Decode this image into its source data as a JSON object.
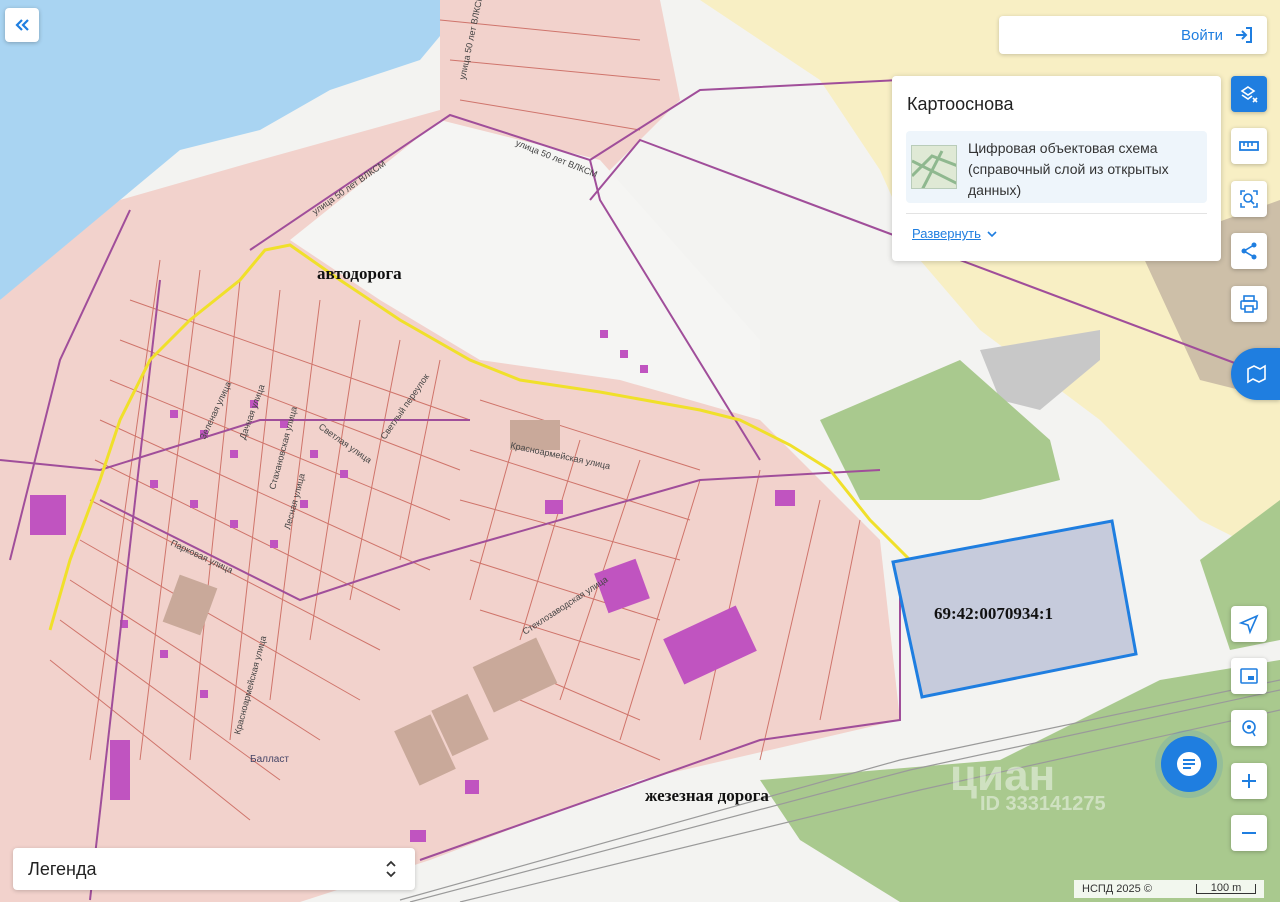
{
  "header": {
    "login_label": "Войти"
  },
  "basemap_panel": {
    "title": "Картооснова",
    "layer_name": "Цифровая объектовая схема (справочный слой из открытых данных)",
    "expand_label": "Развернуть"
  },
  "legend": {
    "label": "Легенда"
  },
  "map_labels": {
    "road": "автодорога",
    "railway": "жезезная дорога",
    "parcel_number": "69:42:0070934:1",
    "water_name": "Балласт",
    "watermark": "циан",
    "watermark_id": "ID 333141275"
  },
  "street_labels": [
    "улица 50 лет ВЛКСМ",
    "улица 50 лет ВЛКСМ",
    "улица 50 лет ВЛКСМ",
    "Красноармейская улица",
    "Стахановская улица",
    "Светлая улица",
    "Светлый переулок",
    "Зеленая улица",
    "Дачная улица",
    "Лесная улица",
    "Парковая улица",
    "Стеклозаводская улица",
    "Красноармейская улица"
  ],
  "attribution": "НСПД 2025 ©",
  "scale": "100 m",
  "icons": [
    "collapse-icon",
    "login-icon",
    "layers-clear-icon",
    "ruler-icon",
    "search-area-icon",
    "share-icon",
    "print-icon",
    "map-tool-icon",
    "navigate-icon",
    "minimap-icon",
    "locate-icon",
    "zoom-in-icon",
    "zoom-out-icon",
    "chat-icon",
    "chevron-down-icon",
    "up-down-icon"
  ],
  "colors": {
    "accent": "#1f7ee0",
    "parcel_fill": "#f2d2cc",
    "parcel_line": "#c9645a",
    "boundary": "#a04e9a",
    "road_highlight": "#f0e02a",
    "water": "#a9d4f2",
    "forest": "#a9c98e",
    "target_parcel": "#c6cbdc"
  }
}
